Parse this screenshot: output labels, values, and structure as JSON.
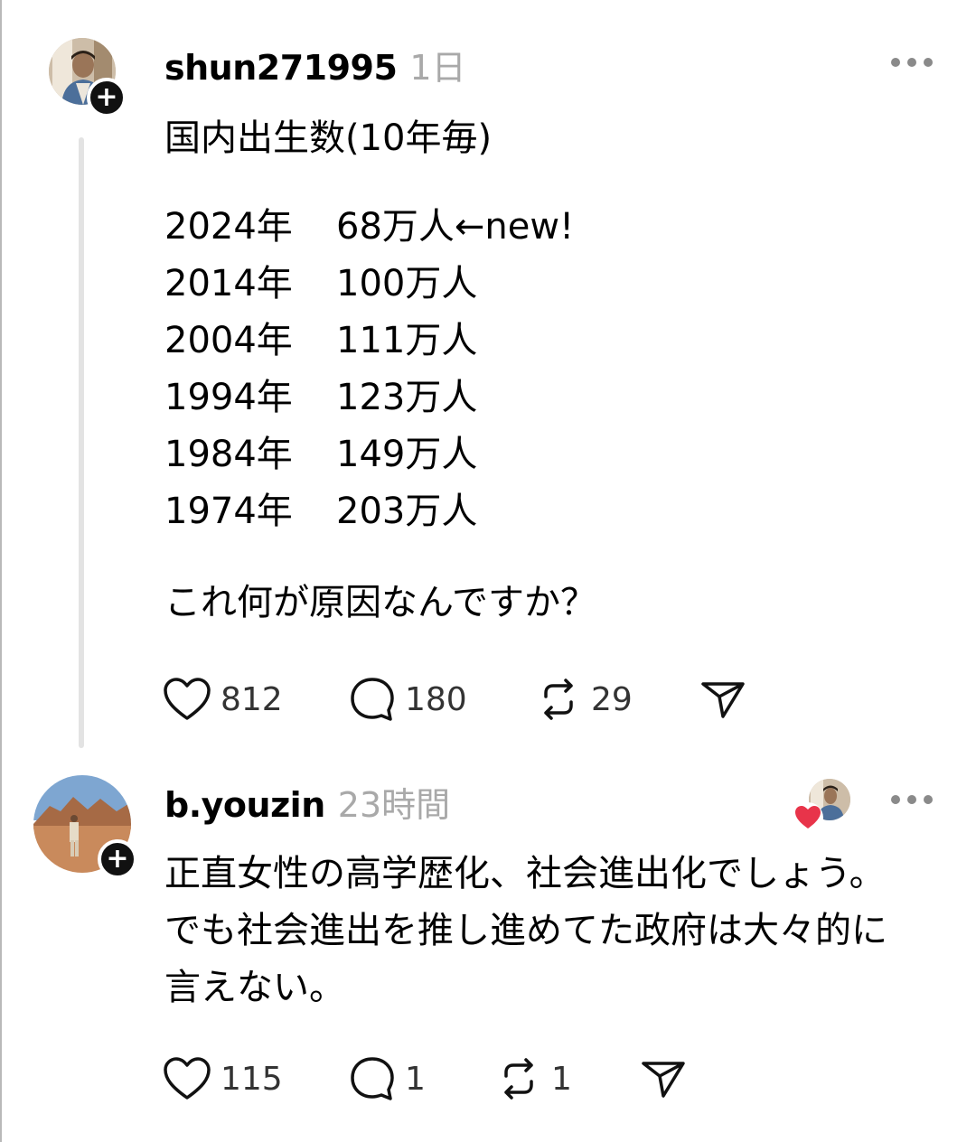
{
  "post": {
    "username": "shun271995",
    "time": "1日",
    "title": "国内出生数(10年毎)",
    "rows": [
      {
        "year": "2024年",
        "value": "68万人←new!"
      },
      {
        "year": "2014年",
        "value": "100万人"
      },
      {
        "year": "2004年",
        "value": "111万人"
      },
      {
        "year": "1994年",
        "value": "123万人"
      },
      {
        "year": "1984年",
        "value": "149万人"
      },
      {
        "year": "1974年",
        "value": "203万人"
      }
    ],
    "question": "これ何が原因なんですか？",
    "likes": "812",
    "comments": "180",
    "reposts": "29"
  },
  "reply": {
    "username": "b.youzin",
    "time": "23時間",
    "text": "正直女性の高学歴化、社会進出化でしょう。でも社会進出を推し進めてた政府は大々的に言えない。",
    "likes": "115",
    "comments": "1",
    "reposts": "1"
  },
  "icons": {
    "like": "heart-icon",
    "comment": "comment-bubble-icon",
    "repost": "repost-icon",
    "share": "send-icon",
    "more": "more-dots-icon",
    "follow": "plus-icon"
  },
  "colors": {
    "liked_heart": "#e8344a",
    "muted_text": "#a9a9a9",
    "thread_line": "#e3e3e3"
  }
}
